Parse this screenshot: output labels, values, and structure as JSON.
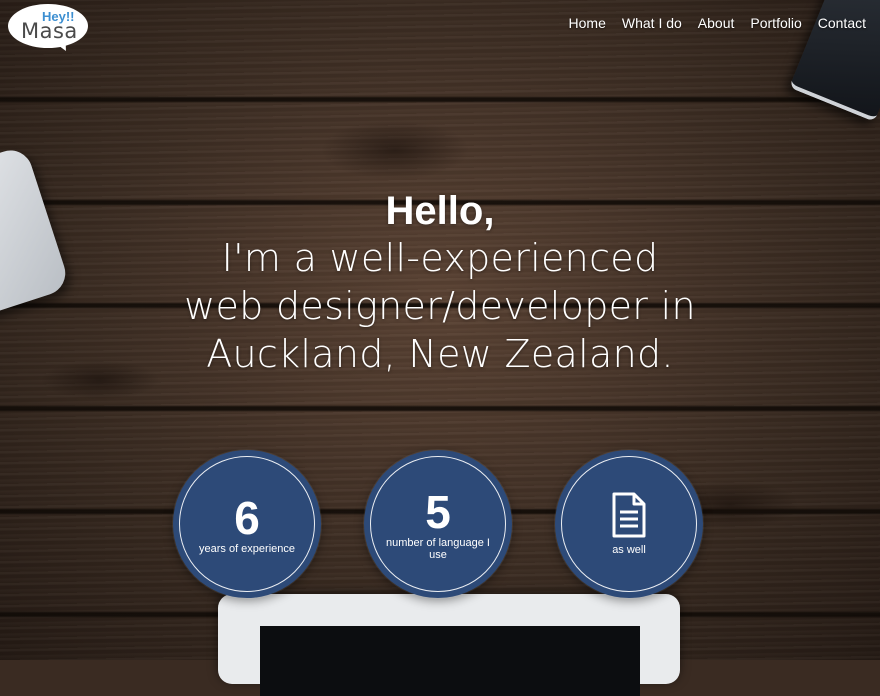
{
  "logo": {
    "top": "Hey!!",
    "bottom": "Masa"
  },
  "nav": {
    "items": [
      "Home",
      "What I do",
      "About",
      "Portfolio",
      "Contact"
    ]
  },
  "hero": {
    "title": "Hello,",
    "lines": [
      "I'm a well-experienced",
      "web designer/developer in",
      "Auckland, New Zealand."
    ]
  },
  "stats": [
    {
      "number": "6",
      "label": "years of experience"
    },
    {
      "number": "5",
      "label": "number of language I use"
    },
    {
      "icon": "document-icon",
      "label": "as well"
    }
  ],
  "colors": {
    "circle": "#2d4a78",
    "logo_accent": "#3d8fd1"
  }
}
